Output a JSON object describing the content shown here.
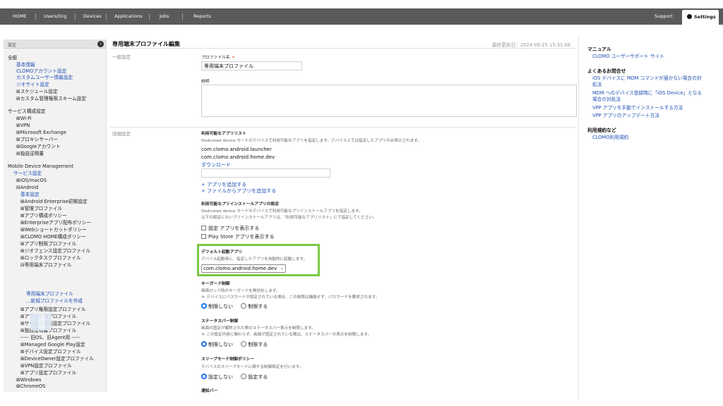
{
  "nav": {
    "items": [
      "HOME",
      "Users/Org",
      "Devices",
      "Applications",
      "Jobs",
      "Reports"
    ],
    "support": "Support",
    "settings": "Settings"
  },
  "sidebar": {
    "header": "設定",
    "lines": [
      {
        "text": "全般",
        "kind": "text"
      },
      {
        "text": "基本情報",
        "kind": "link"
      },
      {
        "text": "CLOMOアカウント設定",
        "kind": "link"
      },
      {
        "text": "カスタムユーザー情報設定",
        "kind": "link"
      },
      {
        "text": "ジオサイト設定",
        "kind": "link"
      },
      {
        "text": "⊞スケジュール設定",
        "kind": "text"
      },
      {
        "text": "⊞カスタム管理権限スキーム設定",
        "kind": "text"
      },
      {
        "text": "サービス構成設定",
        "kind": "text"
      },
      {
        "text": "⊞Wi-Fi",
        "kind": "text"
      },
      {
        "text": "⊞VPN",
        "kind": "text"
      },
      {
        "text": "⊞Microsoft Exchange",
        "kind": "text"
      },
      {
        "text": "⊞プロキシサーバー",
        "kind": "text"
      },
      {
        "text": "⊞Googleアカウント",
        "kind": "text"
      },
      {
        "text": "⊞独自証明書",
        "kind": "text"
      },
      {
        "text": "Mobile Device Management",
        "kind": "text"
      },
      {
        "text": "サービス設定",
        "kind": "link"
      },
      {
        "text": "⊞iOS/macOS",
        "kind": "text"
      },
      {
        "text": "⊟Android",
        "kind": "text"
      },
      {
        "text": "基本設定",
        "kind": "link"
      },
      {
        "text": "⊞Android Enterprise初期設定",
        "kind": "text"
      },
      {
        "text": "⊞管理プロファイル",
        "kind": "text"
      },
      {
        "text": "⊞アプリ構成ポリシー",
        "kind": "text"
      },
      {
        "text": "⊞Enterpriseアプリ配布ポリシー",
        "kind": "text"
      },
      {
        "text": "⊞Webショートカットポリシー",
        "kind": "text"
      },
      {
        "text": "⊞CLOMO HOME構成ポリシー",
        "kind": "text"
      },
      {
        "text": "⊞アプリ制限プロファイル",
        "kind": "text"
      },
      {
        "text": "⊞ジオフェンス設定プロファイル",
        "kind": "text"
      },
      {
        "text": "⊞ロックタスクプロファイル",
        "kind": "text"
      },
      {
        "text": "⊟専用端末プロファイル",
        "kind": "text"
      },
      {
        "text": "専用端末プロファイル",
        "kind": "link"
      },
      {
        "text": "...新規プロファイルを作成",
        "kind": "link"
      },
      {
        "text": "⊞アプリ権限設定プロファイル",
        "kind": "text"
      },
      {
        "text": "⊞アプリ管理プロファイル",
        "kind": "text"
      },
      {
        "text": "⊞サービス接続設定プロファイル",
        "kind": "text"
      },
      {
        "text": "⊞独自証明書プロファイル",
        "kind": "text"
      },
      {
        "text": "----- 旧OS、旧Agent用 -----",
        "kind": "text"
      },
      {
        "text": "⊞Managed Google Play設定",
        "kind": "text"
      },
      {
        "text": "⊞デバイス設定プロファイル",
        "kind": "text"
      },
      {
        "text": "⊞DeviceOwner設定プロファイル",
        "kind": "text"
      },
      {
        "text": "⊞VPN設定プロファイル",
        "kind": "text"
      },
      {
        "text": "⊞アプリ設定プロファイル",
        "kind": "text"
      },
      {
        "text": "⊞Windows",
        "kind": "text"
      },
      {
        "text": "⊞ChromeOS",
        "kind": "text"
      }
    ]
  },
  "main": {
    "title": "専用端末プロファイル編集",
    "last_updated": "最終更新日：2024-09-25 15:31:08",
    "section_general": "一般設定",
    "section_detail": "詳細設定",
    "profile_name_label": "プロファイル名",
    "required_mark": "＊",
    "profile_name_value": "専用端末プロファイル",
    "description_label": "説明",
    "apps_label": "利用可能なアプリリスト",
    "apps_desc": "Dedicated device モードのデバイスで利用可能なアプリを指定します。デバイス上では指定したアプリのみ表示されます。",
    "apps": [
      "com.clomo.android.launcher",
      "com.clomo.android.home.dev"
    ],
    "download_link": "ダウンロード",
    "add_app_link": "+ アプリを追加する",
    "add_file_link": "+ ファイルからアプリを追加する",
    "preinstall_label": "利用可能なプリインストールアプリの設定",
    "preinstall_desc1": "Dedicated device モードのデバイスで利用可能なプリインストールアプリを指定します。",
    "preinstall_desc2": "以下の設定にないプリインストールアプリは、「利用可能なアプリリスト」にて指定してください。",
    "show_settings_app": "設定 アプリを表示する",
    "show_playstore_app": "Play Store アプリを表示する",
    "default_app_label": "デフォルト起動アプリ",
    "default_app_desc": "デバイス起動時に、指定したアプリを自動的に起動します。",
    "default_app_value": "com.clomo.android.home.dev",
    "keyguard_label": "キーガード制御",
    "keyguard_desc1": "画面ロック時のキーガードを無効化します。",
    "keyguard_desc2": "＊ デバイスにパスワードが設定されている場合、この制限は機能せず、パスワードを要求されます。",
    "opt_no_restrict": "制限しない",
    "opt_restrict": "制限する",
    "statusbar_label": "ステータスバー制御",
    "statusbar_desc1": "画面の固定が解除された際のステータスバー表示を制限します。",
    "statusbar_desc2": "＊ この設定内容に関わらず、画面が固定されている間は、ステータスバーの表示を制限します。",
    "sleep_label": "スリープモード制御ポリシー",
    "sleep_desc": "デバイスのスリープモードに関する制御設定を行います。",
    "opt_no_set": "設定しない",
    "opt_set": "設定する",
    "notify_label": "通知バー"
  },
  "right": {
    "manual_heading": "マニュアル",
    "manual_link": "CLOMO ユーザーサポート サイト",
    "faq_heading": "よくあるお問合せ",
    "faq_links": [
      "iOS デバイスに MDM コマンドが届かない場合の対",
      "処法",
      "MDM へのデバイス登録時に「iOS Device」となる",
      "場合の対処法",
      "VPP アプリを手動でインストールする方法",
      "VPP アプリのアップデート方法"
    ],
    "terms_heading": "利用規約など",
    "terms_link": "CLOMO利用規約"
  }
}
